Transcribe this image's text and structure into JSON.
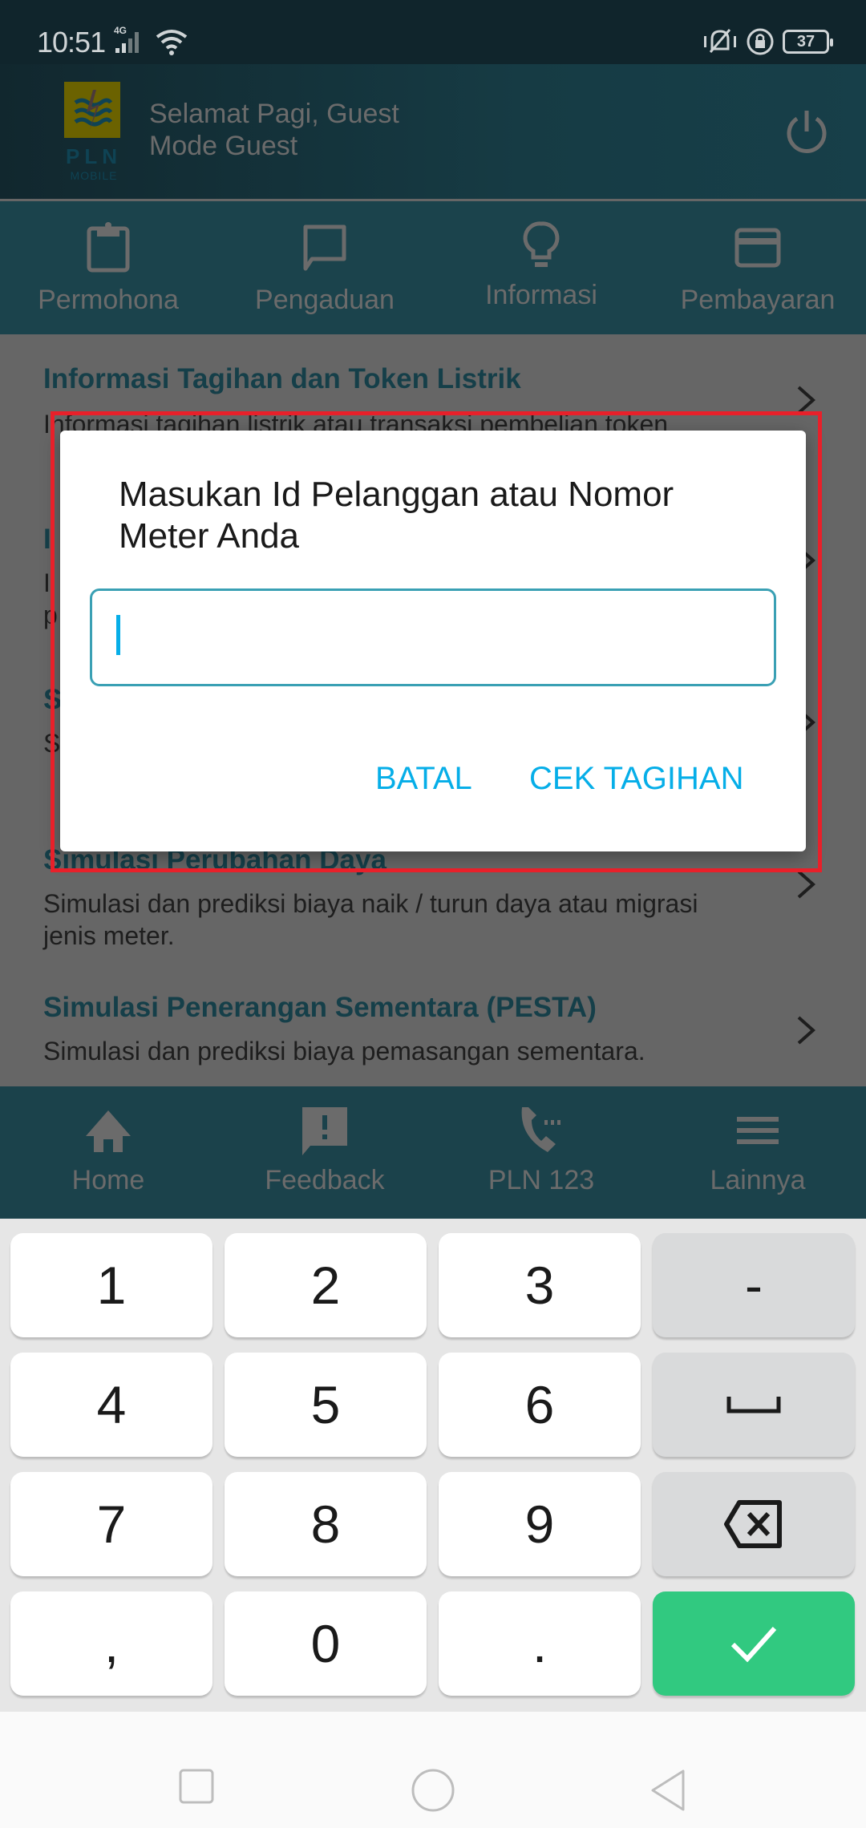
{
  "status_bar": {
    "time": "10:51",
    "network": "4G",
    "battery": "37",
    "icons": [
      "signal-icon",
      "wifi-icon",
      "vibrate-mute-icon",
      "rotation-lock-icon",
      "battery-icon"
    ]
  },
  "header": {
    "logo_text": "PLN",
    "logo_sub": "MOBILE",
    "greeting": "Selamat Pagi, Guest",
    "mode": "Mode Guest"
  },
  "categories": [
    {
      "label": "Permohona",
      "icon": "clipboard-icon"
    },
    {
      "label": "Pengaduan",
      "icon": "chat-bubble-icon"
    },
    {
      "label": "Informasi",
      "icon": "lightbulb-icon",
      "selected": true
    },
    {
      "label": "Pembayaran",
      "icon": "credit-card-icon"
    }
  ],
  "list": [
    {
      "title": "Informasi Tagihan dan Token Listrik",
      "desc": "Informasi tagihan listrik atau transaksi pembelian token"
    },
    {
      "title": "I",
      "desc": "I\np"
    },
    {
      "title": "S",
      "desc": "S"
    },
    {
      "title": "Simulasi Perubahan Daya",
      "desc": "Simulasi dan prediksi biaya naik / turun daya atau migrasi jenis meter."
    },
    {
      "title": "Simulasi Penerangan Sementara (PESTA)",
      "desc": "Simulasi dan prediksi biaya pemasangan sementara."
    }
  ],
  "dialog": {
    "title": "Masukan Id Pelanggan atau Nomor Meter Anda",
    "input_value": "",
    "cancel_label": "BATAL",
    "confirm_label": "CEK TAGIHAN"
  },
  "bottom_nav": [
    {
      "label": "Home",
      "icon": "home-icon"
    },
    {
      "label": "Feedback",
      "icon": "feedback-icon"
    },
    {
      "label": "PLN 123",
      "icon": "phone-icon"
    },
    {
      "label": "Lainnya",
      "icon": "menu-icon"
    }
  ],
  "keyboard": {
    "keys": [
      "1",
      "2",
      "3",
      "-",
      "4",
      "5",
      "6",
      "space",
      "7",
      "8",
      "9",
      "backspace",
      ",",
      "0",
      ".",
      "enter"
    ]
  },
  "colors": {
    "accent": "#06aee8",
    "header_bg": "#1b434c",
    "title_teal": "#153f49",
    "enter_green": "#31c980",
    "highlight_red": "#e8202a"
  }
}
